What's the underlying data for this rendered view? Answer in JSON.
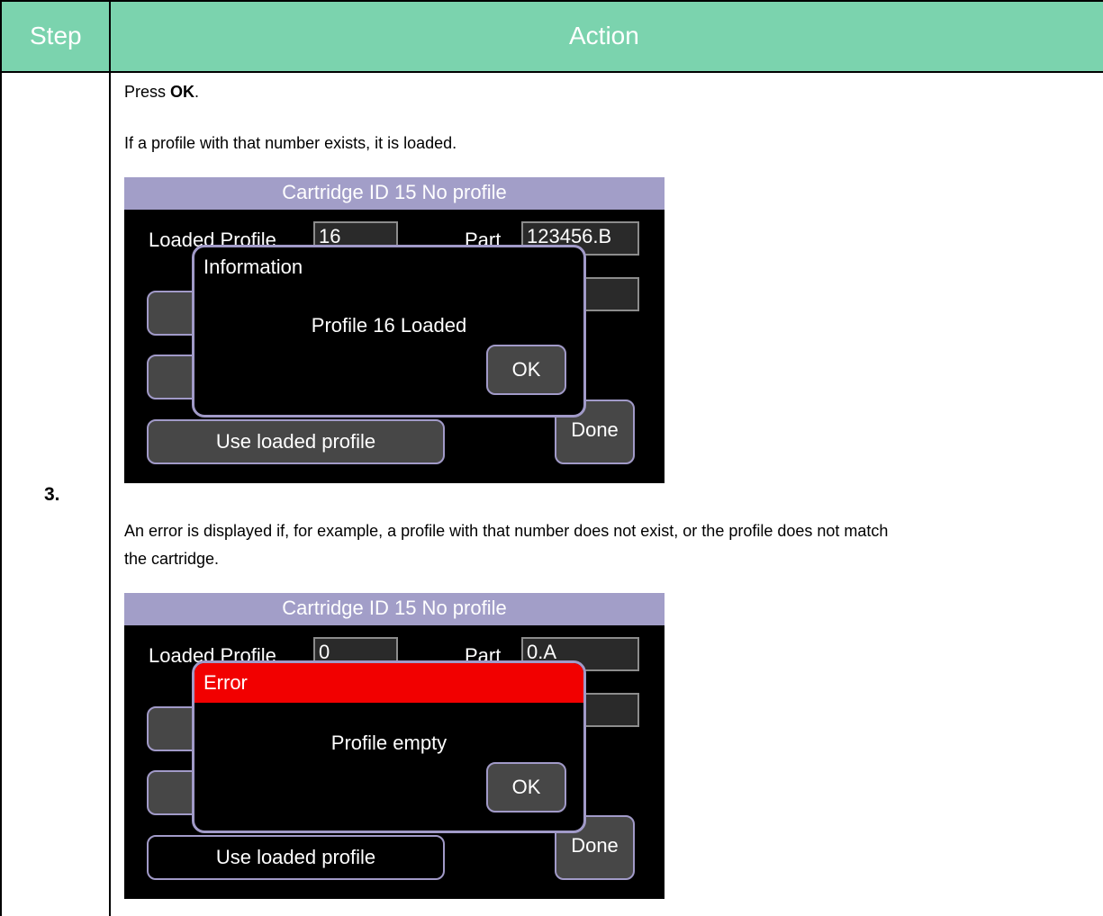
{
  "table": {
    "header_step": "Step",
    "header_action": "Action",
    "step_number": "3.",
    "press_prefix": "Press ",
    "press_key": "OK",
    "press_suffix": ".",
    "loaded_text": "If a profile with that number exists, it is loaded.",
    "error_text_line1": "An error is displayed if, for example, a profile with that number does not exist, or the profile does not match",
    "error_text_line2": "the cartridge."
  },
  "screens": [
    {
      "title": "Cartridge ID 15 No profile",
      "loaded_profile_label": "Loaded Profile",
      "loaded_profile_value": "16",
      "part_label": "Part",
      "part_value": "123456.B",
      "use_loaded_profile_label": "Use loaded profile",
      "done_label": "Done",
      "dialog": {
        "title": "Information",
        "message": "Profile 16 Loaded",
        "ok_label": "OK"
      }
    },
    {
      "title": "Cartridge ID 15 No profile",
      "loaded_profile_label": "Loaded Profile",
      "loaded_profile_value": "0",
      "part_label": "Part",
      "part_value": "0.A",
      "use_loaded_profile_label": "Use loaded profile",
      "done_label": "Done",
      "dialog": {
        "title": "Error",
        "message": "Profile empty",
        "ok_label": "OK"
      }
    }
  ],
  "colors": {
    "header_bg": "#7bd3ae",
    "title_bar": "#a29ec8",
    "error_bar": "#f20000",
    "button_border": "#a19ac8"
  }
}
